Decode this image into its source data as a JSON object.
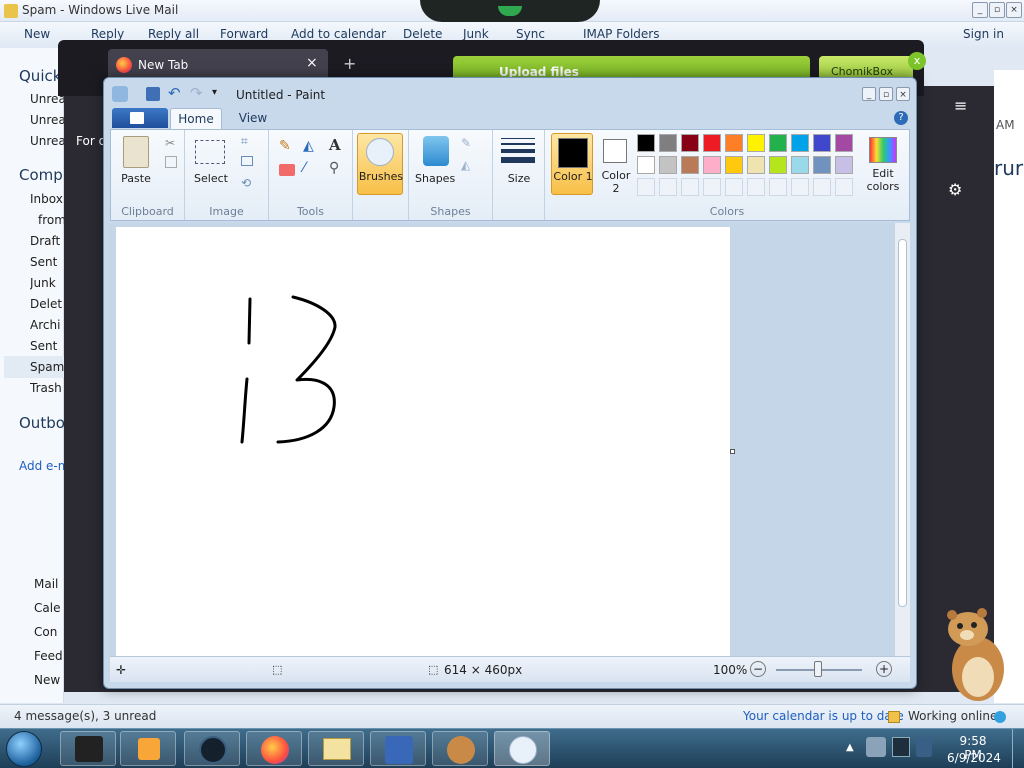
{
  "wlm": {
    "title": "Spam - Windows Live Mail",
    "toolbar": [
      "New",
      "Reply",
      "Reply all",
      "Forward",
      "Add to calendar",
      "Delete",
      "Junk",
      "Sync",
      "IMAP Folders"
    ],
    "sign_in": "Sign in",
    "sidebar": {
      "quick": "Quick",
      "quick_items": [
        "Unrea",
        "Unrea",
        "Unrea"
      ],
      "computer": "Comp",
      "folders": [
        "Inbox",
        "from",
        "Draft",
        "Sent",
        "Junk",
        "Delet",
        "Archi",
        "Sent",
        "Spam",
        "Trash"
      ],
      "outbox": "Outbo",
      "add": "Add e-m",
      "nav": [
        "Mail",
        "Cale",
        "Con",
        "Feed",
        "New"
      ]
    },
    "status_left": "4 message(s), 3 unread",
    "status_calendar": "Your calendar is up to date",
    "status_online": "Working online",
    "right_text": "AM",
    "right_big": "rur"
  },
  "firefox": {
    "tab_title": "New Tab",
    "page_text": "For q",
    "upload_label": "Upload files",
    "chomikbox": "ChomikBox"
  },
  "paint": {
    "title": "Untitled - Paint",
    "tabs": {
      "home": "Home",
      "view": "View"
    },
    "groups": {
      "clipboard": "Clipboard",
      "image": "Image",
      "tools": "Tools",
      "shapes": "Shapes",
      "colors": "Colors"
    },
    "buttons": {
      "paste": "Paste",
      "select": "Select",
      "brushes": "Brushes",
      "shapes": "Shapes",
      "size": "Size",
      "color1": "Color 1",
      "color2": "Color 2",
      "edit_colors": "Edit colors"
    },
    "palette_row1": [
      "#000000",
      "#7f7f7f",
      "#880015",
      "#ed1c24",
      "#ff7f27",
      "#fff200",
      "#22b14c",
      "#00a2e8",
      "#3f48cc",
      "#a349a4"
    ],
    "palette_row2": [
      "#ffffff",
      "#c3c3c3",
      "#b97a57",
      "#ffaec9",
      "#ffc90e",
      "#efe4b0",
      "#b5e61d",
      "#99d9ea",
      "#7092be",
      "#c8bfe7"
    ],
    "color1": "#000000",
    "color2": "#ffffff",
    "status": {
      "size": "614 × 460px",
      "zoom": "100%"
    }
  },
  "taskbar": {
    "time": "9:58 PM",
    "date": "6/9/2024"
  }
}
